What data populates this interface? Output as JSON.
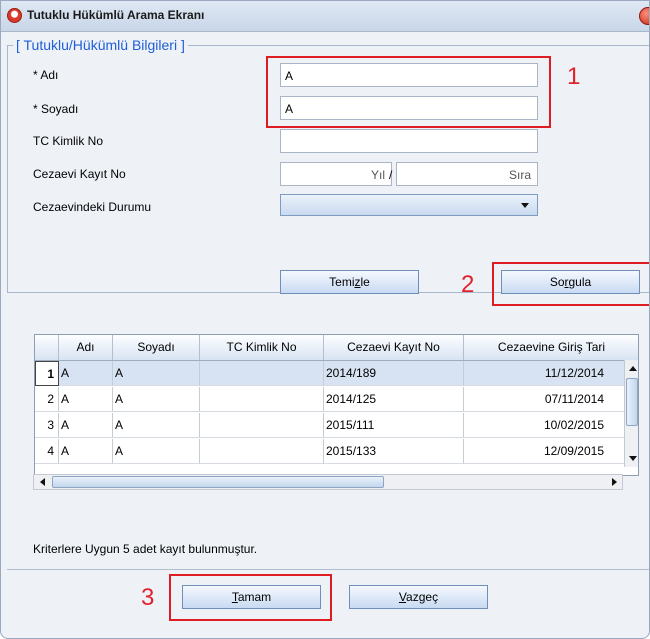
{
  "window": {
    "title": "Tutuklu Hükümlü Arama Ekranı"
  },
  "form": {
    "legend": "[ Tutuklu/Hükümlü Bilgileri ]",
    "adi_label": "* Adı",
    "adi_value": "A",
    "soyadi_label": "* Soyadı",
    "soyadi_value": "A",
    "tc_label": "TC Kimlik No",
    "tc_value": "",
    "kayit_label": "Cezaevi Kayıt No",
    "yil_placeholder": "Yıl",
    "slash": "/",
    "sira_placeholder": "Sıra",
    "durum_label": "Cezaevindeki Durumu",
    "durum_value": ""
  },
  "buttons": {
    "temizle_pre": "Temi",
    "temizle_mn": "z",
    "temizle_post": "le",
    "sorgula_pre": "So",
    "sorgula_mn": "r",
    "sorgula_post": "gula",
    "tamam_pre": "",
    "tamam_mn": "T",
    "tamam_post": "amam",
    "vazgec_pre": "",
    "vazgec_mn": "V",
    "vazgec_post": "azgeç"
  },
  "annotations": {
    "n1": "1",
    "n2": "2",
    "n3": "3"
  },
  "table": {
    "columns": [
      "",
      "Adı",
      "Soyadı",
      "TC Kimlik No",
      "Cezaevi Kayıt No",
      "Cezaevine Giriş Tari"
    ],
    "rows": [
      {
        "no": "1",
        "adi": "A",
        "soyadi": "A",
        "tc": "",
        "kayit": "2014/189",
        "giris": "11/12/2014"
      },
      {
        "no": "2",
        "adi": "A",
        "soyadi": "A",
        "tc": "",
        "kayit": "2014/125",
        "giris": "07/11/2014"
      },
      {
        "no": "3",
        "adi": "A",
        "soyadi": "A",
        "tc": "",
        "kayit": "2015/111",
        "giris": "10/02/2015"
      },
      {
        "no": "4",
        "adi": "A",
        "soyadi": "A",
        "tc": "",
        "kayit": "2015/133",
        "giris": "12/09/2015"
      }
    ],
    "selected_row": 0
  },
  "status": {
    "text": "Kriterlere Uygun 5 adet kayıt bulunmuştur."
  },
  "colors": {
    "accent": "#1f5ed8",
    "annotation_red": "#dd1c24",
    "selection": "#d7e3f2"
  },
  "icons": {
    "title": "app-logo-icon",
    "close": "close-icon"
  }
}
